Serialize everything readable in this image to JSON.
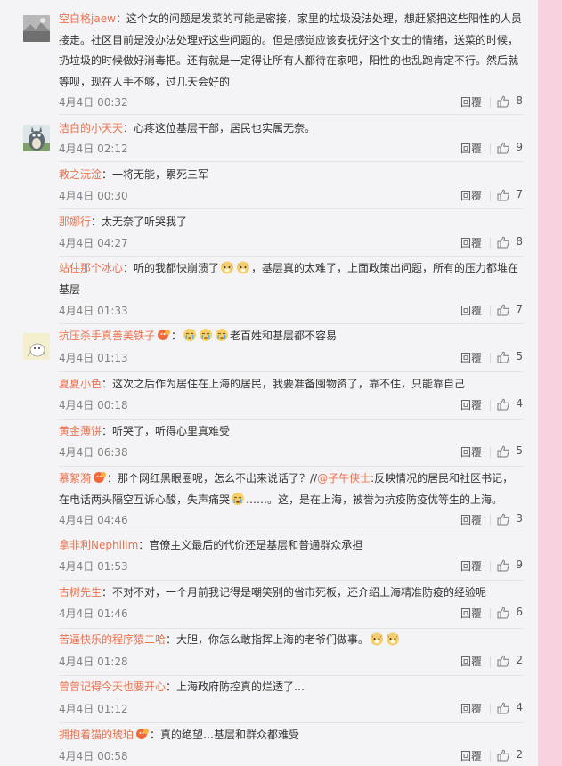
{
  "labels": {
    "reply": "回覆"
  },
  "comments": [
    {
      "username": "空白格jaew",
      "text": "：这个女的问题是发菜的可能是密接，家里的垃圾没法处理，想赶紧把这些阳性的人员接走。社区目前是没办法处理好这些问题的。但是感觉应该安抚好这个女士的情绪，送菜的时候，扔垃圾的时候做好消毒把。还有就是一定得让所有人都待在家吧，阳性的也乱跑肯定不行。然后就等呗，现在人手不够，过几天会好的",
      "time": "4月4日 00:32",
      "likes": "8",
      "avatar": "landscape"
    },
    {
      "username": "洁白的小天天",
      "text": "：心疼这位基层干部，居民也实属无奈。",
      "time": "4月4日 02:12",
      "likes": "9",
      "avatar": "totoro"
    },
    {
      "username": "教之沅淦",
      "text": "：一将无能，累死三军",
      "time": "4月4日 00:30",
      "likes": "7"
    },
    {
      "username": "那娜行",
      "text": "：太无奈了听哭我了",
      "time": "4月4日 04:27",
      "likes": "8"
    },
    {
      "username": "站住那个冰心",
      "text_a": "：听的我都快崩溃了",
      "text_b": "，基层真的太难了，上面政策出问题，所有的压力都堆在基层",
      "time": "4月4日 01:33",
      "likes": "7"
    },
    {
      "username": "抗压杀手真善美铁子",
      "text_a": "：",
      "text_b": "老百姓和基层都不容易",
      "time": "4月4日 01:13",
      "likes": "5",
      "avatar": "cartoon"
    },
    {
      "username": "夏夏小色",
      "text": "：这次之后作为居住在上海的居民，我要准备囤物资了，靠不住，只能靠自己",
      "time": "4月4日 00:18",
      "likes": "4"
    },
    {
      "username": "黄金薄饼",
      "text": "：听哭了，听得心里真难受",
      "time": "4月4日 06:38",
      "likes": "5"
    },
    {
      "username": "慕絮漪",
      "text_a": "：那个网红黑眼圈呢，怎么不出来说话了？//",
      "mention": "@子午侠士",
      "text_b": ":反映情况的居民和社区书记，在电话两头隔空互诉心酸，失声痛哭",
      "text_c": "……。这，是在上海，被誉为抗疫防疫优等生的上海。",
      "time": "4月4日 04:46",
      "likes": "3"
    },
    {
      "username": "拿非利Nephilim",
      "text": "：官僚主义最后的代价还是基层和普通群众承担",
      "time": "4月4日 01:53",
      "likes": "9"
    },
    {
      "username": "古树先生",
      "text": "：不对不对，一个月前我记得是嘲笑别的省市死板，还介绍上海精准防疫的经验呢",
      "time": "4月4日 01:46",
      "likes": "6"
    },
    {
      "username": "苦逼快乐的程序猿二哈",
      "text": "：大胆，你怎么敢指挥上海的老爷们做事。",
      "time": "4月4日 01:28",
      "likes": "2"
    },
    {
      "username": "曾曾记得今天也要开心",
      "text": "：上海政府防控真的烂透了…",
      "time": "4月4日 01:12",
      "likes": "4"
    },
    {
      "username": "拥抱着猫的琥珀",
      "text": "：真的绝望…基层和群众都难受",
      "time": "4月4日 00:58",
      "likes": "2"
    }
  ],
  "colors": {
    "username": "#eb7350",
    "timestamp": "#808080",
    "panel": "#f4f4f6",
    "side": "#f6d9e2"
  },
  "icons": [
    "like-icon",
    "doge-emoji",
    "crying-emoji",
    "vip-badge"
  ]
}
